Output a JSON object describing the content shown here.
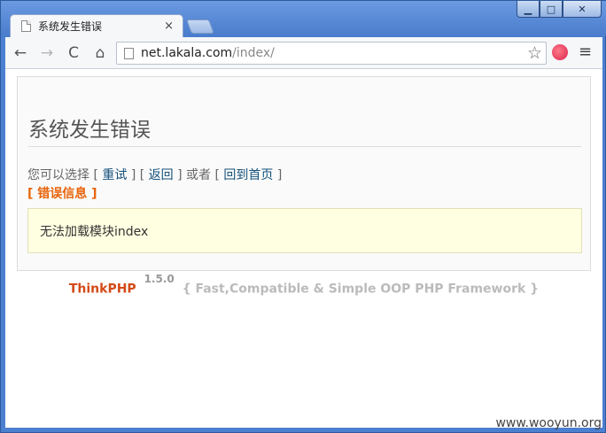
{
  "browser": {
    "tab_title": "系统发生错误",
    "tab_close": "×",
    "url_host": "net.lakala.com",
    "url_path": "/index/",
    "window_min": "▁",
    "window_max": "□",
    "window_close": "✕",
    "nav": {
      "back": "←",
      "forward": "→",
      "reload": "C",
      "home": "⌂"
    },
    "star": "☆",
    "menu": "≡"
  },
  "page": {
    "title": "系统发生错误",
    "options_prefix": "您可以选择 [",
    "retry": "重试",
    "sep1": "] [",
    "back": "返回",
    "sep2": "] 或者 [",
    "home": "回到首页",
    "sep3": "]",
    "error_info": "[ 错误信息 ]",
    "message": "无法加载模块index"
  },
  "footer": {
    "brand": "ThinkPHP",
    "version": "1.5.0",
    "slogan": "{ Fast,Compatible & Simple OOP PHP Framework }"
  },
  "watermark": "www.wooyun.org",
  "colors": {
    "frame": "#4b7fcf",
    "link": "#14507a",
    "error_info": "#e8630a",
    "message_bg": "#ffffe1",
    "brand": "#d34a17"
  }
}
